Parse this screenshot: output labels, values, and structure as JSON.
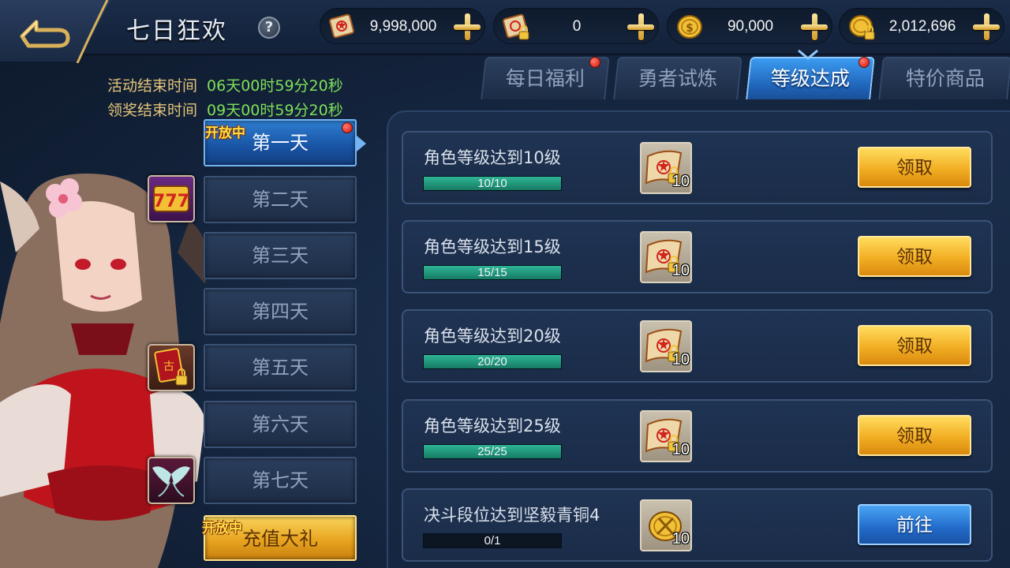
{
  "header": {
    "title": "七日狂欢",
    "help_label": "?"
  },
  "currencies": [
    {
      "icon": "scroll-icon",
      "value": "9,998,000"
    },
    {
      "icon": "locked-scroll-icon",
      "value": "0"
    },
    {
      "icon": "gold-coin-icon",
      "value": "90,000"
    },
    {
      "icon": "locked-coin-icon",
      "value": "2,012,696"
    }
  ],
  "timers": {
    "event_label": "活动结束时间",
    "event_value": "06天00时59分20秒",
    "claim_label": "领奖结束时间",
    "claim_value": "09天00时59分20秒"
  },
  "days": [
    {
      "label": "第一天",
      "open_tag": "开放中",
      "active": true,
      "badge": true
    },
    {
      "label": "第二天",
      "icon": "slot-777-icon"
    },
    {
      "label": "第三天"
    },
    {
      "label": "第四天"
    },
    {
      "label": "第五天",
      "icon": "locked-book-icon"
    },
    {
      "label": "第六天"
    },
    {
      "label": "第七天",
      "icon": "wings-icon"
    }
  ],
  "recharge": {
    "label": "充值大礼",
    "open_tag": "开放中"
  },
  "tabs": [
    {
      "label": "每日福利",
      "badge": true
    },
    {
      "label": "勇者试炼",
      "badge": false
    },
    {
      "label": "等级达成",
      "badge": true,
      "active": true
    },
    {
      "label": "特价商品",
      "badge": false
    }
  ],
  "tasks": [
    {
      "title": "角色等级达到10级",
      "progress": "10/10",
      "progress_ratio": 1.0,
      "reward_icon": "locked-scroll-icon",
      "reward_count": "10",
      "button": "领取",
      "button_style": "gold"
    },
    {
      "title": "角色等级达到15级",
      "progress": "15/15",
      "progress_ratio": 1.0,
      "reward_icon": "locked-scroll-icon",
      "reward_count": "10",
      "button": "领取",
      "button_style": "gold"
    },
    {
      "title": "角色等级达到20级",
      "progress": "20/20",
      "progress_ratio": 1.0,
      "reward_icon": "locked-scroll-icon",
      "reward_count": "10",
      "button": "领取",
      "button_style": "gold"
    },
    {
      "title": "角色等级达到25级",
      "progress": "25/25",
      "progress_ratio": 1.0,
      "reward_icon": "locked-scroll-icon",
      "reward_count": "10",
      "button": "领取",
      "button_style": "gold"
    },
    {
      "title": "决斗段位达到坚毅青铜4",
      "progress": "0/1",
      "progress_ratio": 0.0,
      "reward_icon": "duel-coin-icon",
      "reward_count": "10",
      "button": "前往",
      "button_style": "blue"
    }
  ],
  "colors": {
    "accent_gold": "#f2ae23",
    "accent_blue": "#2169c8",
    "timer_label": "#e3c47a",
    "timer_value": "#7ee05a",
    "progress_fill": "#1f9a7c"
  }
}
